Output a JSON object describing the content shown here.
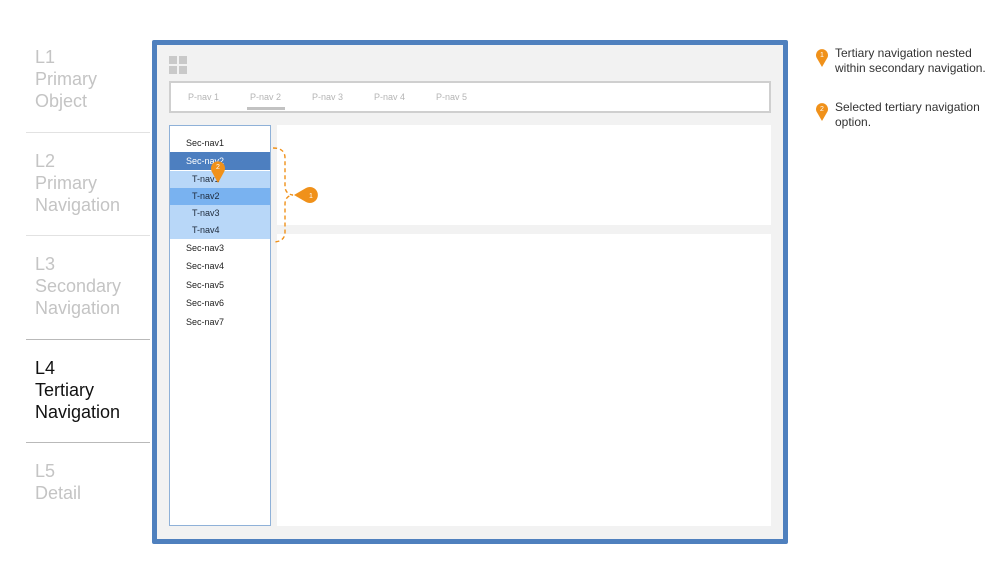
{
  "levels": [
    {
      "line1": "L1",
      "line2": "Primary",
      "line3": "Object",
      "active": false
    },
    {
      "line1": "L2",
      "line2": "Primary",
      "line3": "Navigation",
      "active": false
    },
    {
      "line1": "L3",
      "line2": "Secondary",
      "line3": "Navigation",
      "active": false
    },
    {
      "line1": "L4",
      "line2": "Tertiary",
      "line3": "Navigation",
      "active": true
    },
    {
      "line1": "L5",
      "line2": "Detail",
      "active": false
    }
  ],
  "primary_nav": {
    "items": [
      "P-nav 1",
      "P-nav 2",
      "P-nav 3",
      "P-nav 4",
      "P-nav 5"
    ],
    "selected": "P-nav 2"
  },
  "secondary_nav": {
    "items": [
      "Sec-nav1",
      "Sec-nav2",
      "Sec-nav3",
      "Sec-nav4",
      "Sec-nav5",
      "Sec-nav6",
      "Sec-nav7"
    ],
    "selected": "Sec-nav2"
  },
  "tertiary_nav": {
    "items": [
      "T-nav1",
      "T-nav2",
      "T-nav3",
      "T-nav4"
    ],
    "selected": "T-nav2"
  },
  "markers": [
    {
      "number": "1",
      "text": "Tertiary navigation nested within secondary navigation."
    },
    {
      "number": "2",
      "text": "Selected tertiary navigation option."
    }
  ],
  "colors": {
    "frame": "#4f80be",
    "secondary_selected": "#4d7fc0",
    "tertiary_bg": "#b8d7f8",
    "tertiary_selected": "#79b2f0",
    "marker": "#f0911a"
  },
  "icons": {
    "app_grid": "grid-icon",
    "marker": "map-pin-icon"
  }
}
